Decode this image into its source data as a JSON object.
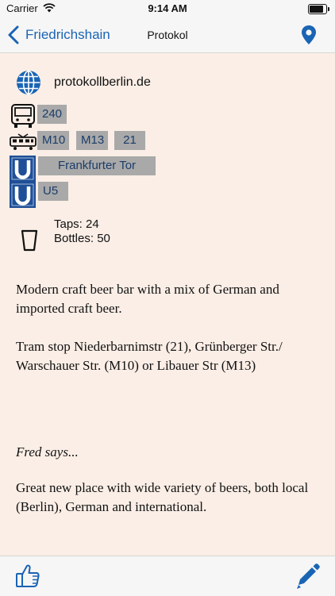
{
  "status_bar": {
    "carrier": "Carrier",
    "time": "9:14 AM",
    "battery_level": 0.95
  },
  "nav": {
    "back_label": "Friedrichshain",
    "title": "Protokol"
  },
  "website": "protokollberlin.de",
  "transport": {
    "bus": [
      "240"
    ],
    "tram": [
      "M10",
      "M13",
      "21"
    ],
    "ubahn_stations": [
      "Frankfurter Tor"
    ],
    "ubahn_lines": [
      "U5"
    ]
  },
  "drinks": {
    "taps": "Taps: 24",
    "bottles": "Bottles: 50"
  },
  "description": [
    "Modern craft beer bar with a mix of German and imported craft beer.",
    "Tram stop Niederbarnimstr (21), Grünberger Str./ Warschauer Str. (M10) or Libauer Str (M13)"
  ],
  "fred": {
    "heading": "Fred says...",
    "comment": "Great new place with wide variety of beers, both local (Berlin), German and international."
  },
  "colors": {
    "accent": "#1a64b4",
    "ubahn": "#1f4f98",
    "chip_bg": "#a9a9a9",
    "chip_text": "#1b3d69",
    "background": "#faeee6"
  },
  "icons": [
    "wifi-icon",
    "battery-icon",
    "back-chevron-icon",
    "map-pin-icon",
    "globe-icon",
    "bus-icon",
    "tram-icon",
    "ubahn-icon",
    "cup-icon",
    "thumbs-up-icon",
    "pencil-icon"
  ]
}
